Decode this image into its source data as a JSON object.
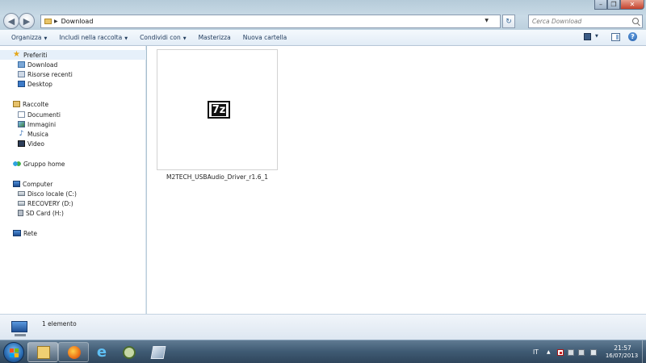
{
  "address_bar": {
    "path_label": "Download",
    "refresh_glyph": "↻"
  },
  "search": {
    "placeholder": "Cerca Download"
  },
  "toolbar": {
    "organize": "Organizza",
    "include_in_library": "Includi nella raccolta",
    "share_with": "Condividi con",
    "burn": "Masterizza",
    "new_folder": "Nuova cartella",
    "help_glyph": "?"
  },
  "nav_pane": {
    "favorites": {
      "label": "Preferiti",
      "items": [
        "Download",
        "Risorse recenti",
        "Desktop"
      ]
    },
    "libraries": {
      "label": "Raccolte",
      "items": [
        "Documenti",
        "Immagini",
        "Musica",
        "Video"
      ]
    },
    "homegroup": {
      "label": "Gruppo home"
    },
    "computer": {
      "label": "Computer",
      "items": [
        "Disco locale (C:)",
        "RECOVERY (D:)",
        "SD Card (H:)"
      ]
    },
    "network": {
      "label": "Rete"
    }
  },
  "content": {
    "file_name": "M2TECH_USBAudio_Driver_r1.6_1",
    "file_icon": "7z"
  },
  "status_bar": {
    "item_count": "1 elemento"
  },
  "taskbar": {
    "language": "IT",
    "time": "21:57",
    "date": "16/07/2013"
  }
}
